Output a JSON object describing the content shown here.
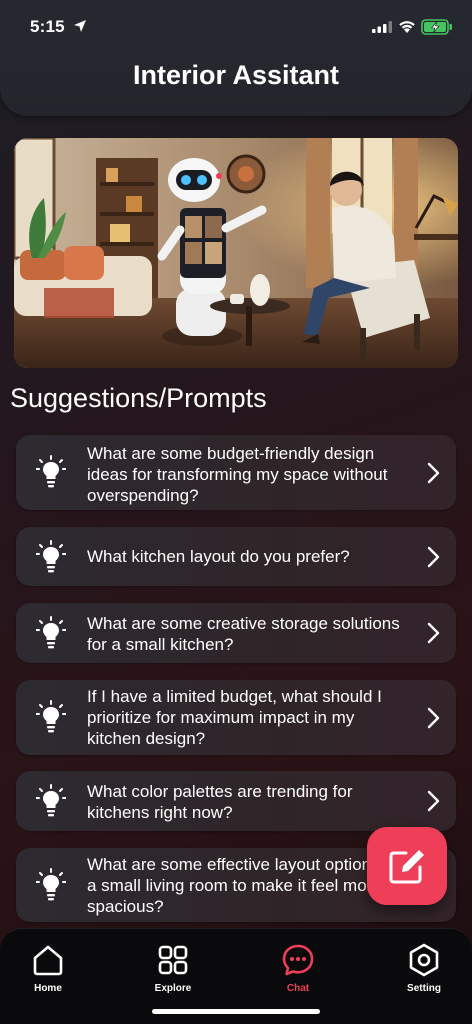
{
  "status": {
    "time": "5:15"
  },
  "header": {
    "title": "Interior Assitant"
  },
  "section": {
    "title": "Suggestions/Prompts"
  },
  "prompts": [
    {
      "text": "What are some budget-friendly design ideas for transforming my space without overspending?"
    },
    {
      "text": "What kitchen layout do you prefer?"
    },
    {
      "text": "What are some creative storage solutions for a small kitchen?"
    },
    {
      "text": "If I have a limited budget, what should I prioritize for maximum impact in my kitchen design?"
    },
    {
      "text": "What color palettes are trending for kitchens right now?"
    },
    {
      "text": "What are some effective layout options for a small living room to make it feel more spacious?"
    }
  ],
  "tabs": [
    {
      "label": "Home",
      "icon": "home-icon"
    },
    {
      "label": "Explore",
      "icon": "grid-icon"
    },
    {
      "label": "Chat",
      "icon": "chat-icon"
    },
    {
      "label": "Setting",
      "icon": "settings-icon"
    }
  ],
  "colors": {
    "accent": "#ef3f58",
    "background": "#24161c",
    "card": "#2f2529"
  }
}
